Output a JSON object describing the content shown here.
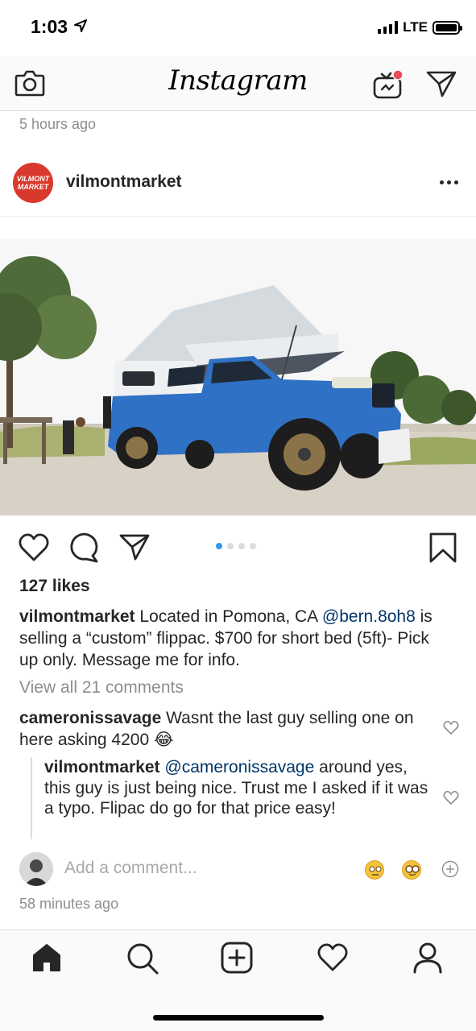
{
  "status": {
    "time": "1:03",
    "network": "LTE"
  },
  "app": {
    "title": "Instagram"
  },
  "feed": {
    "previous_post_time": "5 hours ago"
  },
  "post": {
    "username": "vilmontmarket",
    "avatar_text": "VILMONT MARKET",
    "carousel": {
      "total": 4,
      "active": 1
    },
    "likes": "127 likes",
    "caption": {
      "username": "vilmontmarket",
      "text_1": "Located in Pomona, CA",
      "mention": "@bern.8oh8",
      "text_2": "is selling a “custom” flippac. $700 for short bed (5ft)- Pick up only. Message me for info."
    },
    "view_all": "View all 21 comments",
    "comments": [
      {
        "username": "cameronissavage",
        "text": "Wasnt the last guy selling one on here asking 4200",
        "emoji": "😂"
      },
      {
        "username": "vilmontmarket",
        "mention": "@cameronissavage",
        "text": "around yes, this guy is just being nice. Trust me I asked if it was a typo. Flipac do go for that price easy!"
      }
    ],
    "add_comment_placeholder": "Add a comment...",
    "time": "58 minutes ago"
  },
  "colors": {
    "accent": "#3897f0",
    "mention": "#003569",
    "muted": "#8e8e8e",
    "notification": "#ed4956",
    "brand_red": "#d9392c"
  },
  "icons": [
    "camera-icon",
    "igtv-icon",
    "direct-send-icon",
    "more-icon",
    "heart-icon",
    "comment-icon",
    "share-icon",
    "bookmark-icon",
    "home-icon",
    "search-icon",
    "add-post-icon",
    "activity-icon",
    "profile-icon"
  ]
}
